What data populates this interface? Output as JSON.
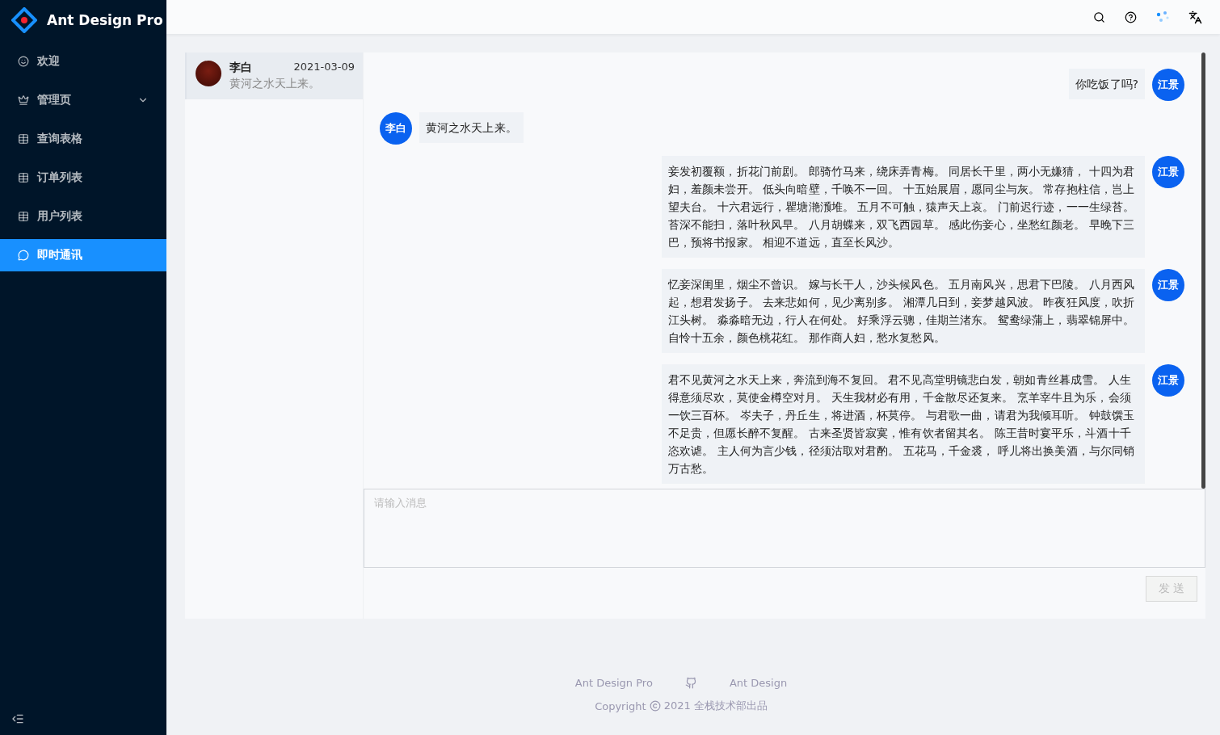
{
  "sidebar": {
    "title": "Ant Design Pro",
    "items": [
      {
        "label": "欢迎",
        "kind": "smile",
        "selected": false
      },
      {
        "label": "管理页",
        "kind": "crown",
        "selected": false,
        "expanded": false
      },
      {
        "label": "查询表格",
        "kind": "table",
        "selected": false
      },
      {
        "label": "订单列表",
        "kind": "table",
        "selected": false
      },
      {
        "label": "用户列表",
        "kind": "table",
        "selected": false
      },
      {
        "label": "即时通讯",
        "kind": "wechat",
        "selected": true
      }
    ]
  },
  "contacts": [
    {
      "name": "李白",
      "date": "2021-03-09",
      "preview": "黄河之水天上来。",
      "selected": true
    }
  ],
  "messages": [
    {
      "sender": "江景",
      "kind": "outgoing",
      "text": "你吃饭了吗?"
    },
    {
      "sender": "李白",
      "kind": "incoming",
      "text": "黄河之水天上来。"
    },
    {
      "sender": "江景",
      "kind": "outgoing",
      "text": "妾发初覆额，折花门前剧。 郎骑竹马来，绕床弄青梅。 同居长干里，两小无嫌猜， 十四为君妇，羞颜未尝开。 低头向暗壁，千唤不一回。 十五始展眉，愿同尘与灰。 常存抱柱信，岂上望夫台。 十六君远行，瞿塘滟滪堆。 五月不可触，猿声天上哀。 门前迟行迹，一一生绿苔。苔深不能扫，落叶秋风早。 八月胡蝶来，双飞西园草。 感此伤妾心，坐愁红颜老。 早晚下三巴，预将书报家。 相迎不道远，直至长风沙。"
    },
    {
      "sender": "江景",
      "kind": "outgoing",
      "text": "忆妾深闺里，烟尘不曾识。 嫁与长干人，沙头候风色。 五月南风兴，思君下巴陵。 八月西风起，想君发扬子。 去来悲如何，见少离别多。 湘潭几日到，妾梦越风波。 昨夜狂风度，吹折江头树。 淼淼暗无边，行人在何处。 好乘浮云骢，佳期兰渚东。 鸳鸯绿蒲上，翡翠锦屏中。自怜十五余，颜色桃花红。 那作商人妇，愁水复愁风。"
    },
    {
      "sender": "江景",
      "kind": "outgoing",
      "text": "君不见黄河之水天上来，奔流到海不复回。 君不见高堂明镜悲白发，朝如青丝暮成雪。 人生得意须尽欢，莫使金樽空对月。 天生我材必有用，千金散尽还复来。 烹羊宰牛且为乐，会须一饮三百杯。 岑夫子，丹丘生，将进酒，杯莫停。 与君歌一曲，请君为我倾耳听。 钟鼓馔玉不足贵，但愿长醉不复醒。 古来圣贤皆寂寞，惟有饮者留其名。 陈王昔时宴平乐，斗酒十千恣欢谑。 主人何为言少钱，径须沽取对君酌。 五花马，千金裘， 呼儿将出换美酒，与尔同销万古愁。"
    }
  ],
  "composer": {
    "placeholder": "请输入消息",
    "send_label": "发 送",
    "send_disabled": true
  },
  "footer": {
    "links": [
      "Ant Design Pro",
      "Ant Design"
    ],
    "copyright_prefix": "Copyright",
    "copyright_text": "2021 全栈技术部出品"
  }
}
